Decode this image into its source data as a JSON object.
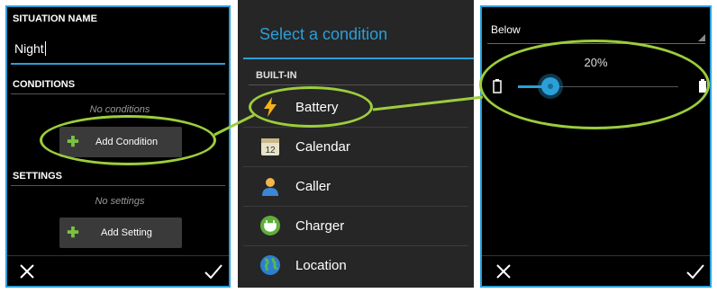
{
  "left_panel": {
    "situation_label": "SITUATION NAME",
    "situation_value": "Night",
    "conditions_label": "CONDITIONS",
    "no_conditions": "No conditions",
    "add_condition": "Add Condition",
    "settings_label": "SETTINGS",
    "no_settings": "No settings",
    "add_setting": "Add Setting"
  },
  "middle_panel": {
    "title": "Select a condition",
    "section": "BUILT-IN",
    "items": [
      {
        "label": "Battery",
        "icon": "lightning-icon"
      },
      {
        "label": "Calendar",
        "icon": "calendar-icon"
      },
      {
        "label": "Caller",
        "icon": "person-icon"
      },
      {
        "label": "Charger",
        "icon": "plug-icon"
      },
      {
        "label": "Location",
        "icon": "globe-icon"
      }
    ]
  },
  "right_panel": {
    "dropdown_value": "Below",
    "slider_percent_label": "20%",
    "slider_fraction": 0.2
  },
  "colors": {
    "accent": "#2b9fd8",
    "highlight": "#9ccd3c",
    "plus": "#7cc242"
  }
}
